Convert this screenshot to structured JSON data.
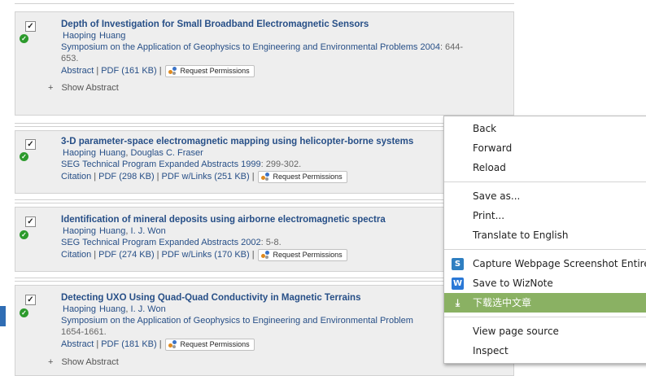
{
  "results": [
    {
      "title": "Depth of Investigation for Small Broadband Electromagnetic Sensors",
      "authors": [
        "Haoping",
        "Huang"
      ],
      "source": "Symposium on the Application of Geophysics to Engineering and Environmental Problems 2004",
      "pages": ": 644-",
      "pages2": "653.",
      "links": [
        "Abstract",
        "PDF (161 KB)"
      ],
      "permissions": "Request Permissions",
      "show_abstract": "Show Abstract"
    },
    {
      "title": "3-D parameter-space electromagnetic mapping using helicopter-borne systems",
      "authors": [
        "Haoping",
        "Huang",
        "Douglas C. Fraser"
      ],
      "source": "SEG Technical Program Expanded Abstracts 1999",
      "pages": ": 299-302.",
      "links": [
        "Citation",
        "PDF (298 KB)",
        "PDF w/Links (251 KB)"
      ],
      "permissions": "Request Permissions"
    },
    {
      "title": "Identification of mineral deposits using airborne electromagnetic spectra",
      "authors": [
        "Haoping",
        "Huang",
        "I. J. Won"
      ],
      "source": "SEG Technical Program Expanded Abstracts 2002",
      "pages": ": 5-8.",
      "links": [
        "Citation",
        "PDF (274 KB)",
        "PDF w/Links (170 KB)"
      ],
      "permissions": "Request Permissions"
    },
    {
      "title": "Detecting UXO Using Quad-Quad Conductivity in Magnetic Terrains",
      "authors": [
        "Haoping",
        "Huang",
        "I. J. Won"
      ],
      "source": "Symposium on the Application of Geophysics to Engineering and Environmental Problem",
      "pages2": "1654-1661.",
      "links": [
        "Abstract",
        "PDF (181 KB)"
      ],
      "permissions": "Request Permissions",
      "show_abstract": "Show Abstract"
    }
  ],
  "context_menu": {
    "items": [
      "Back",
      "Forward",
      "Reload",
      "Save as...",
      "Print...",
      "Translate to English",
      "Capture Webpage Screenshot Entirely",
      "Save to WizNote",
      "下载选中文章",
      "View page source",
      "Inspect"
    ],
    "icons": [
      "camera-icon",
      "wiznote-icon",
      "download-icon"
    ],
    "highlight_color": "#8ab163"
  },
  "colors": {
    "link": "#274f87",
    "card_bg": "#eeeeee",
    "check_green": "#2c9a2c"
  }
}
